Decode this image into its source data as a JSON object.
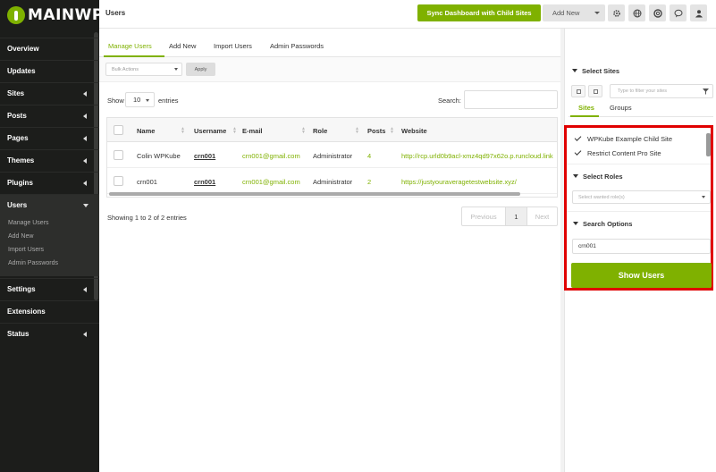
{
  "brand": {
    "logo_text": "MAINWP",
    "accent": "#7fb100",
    "sidebar_bg": "#1c1d1b",
    "highlight": "#e00000"
  },
  "sidebar": {
    "items": [
      {
        "label": "Overview",
        "arrow": false
      },
      {
        "label": "Updates",
        "arrow": false
      },
      {
        "label": "Sites",
        "arrow": true
      },
      {
        "label": "Posts",
        "arrow": true
      },
      {
        "label": "Pages",
        "arrow": true
      },
      {
        "label": "Themes",
        "arrow": true
      },
      {
        "label": "Plugins",
        "arrow": true
      },
      {
        "label": "Users",
        "arrow": true,
        "open": true
      },
      {
        "label": "Settings",
        "arrow": true
      },
      {
        "label": "Extensions",
        "arrow": false
      },
      {
        "label": "Status",
        "arrow": true
      }
    ],
    "submenu": [
      "Manage Users",
      "Add New",
      "Import Users",
      "Admin Passwords"
    ]
  },
  "header": {
    "title": "Users",
    "sync_label": "Sync Dashboard with Child Sites",
    "add_new_label": "Add New",
    "icons": [
      "gear-icon",
      "globe-icon",
      "help-icon",
      "chat-icon",
      "user-icon"
    ]
  },
  "tabs": [
    "Manage Users",
    "Add New",
    "Import Users",
    "Admin Passwords"
  ],
  "actions": {
    "bulk_placeholder": "Bulk Actions",
    "apply_label": "Apply"
  },
  "entries": {
    "show": "Show",
    "value": "10",
    "suffix": "entries",
    "search_label": "Search:"
  },
  "table": {
    "columns": [
      "Name",
      "Username",
      "E-mail",
      "Role",
      "Posts",
      "Website"
    ],
    "rows": [
      {
        "name": "Colin WPKube",
        "username": "crn001",
        "email": "crn001@gmail.com",
        "role": "Administrator",
        "posts": "4",
        "website": "http://rcp.urld0b9acl-xmz4qd97x62o.p.runcloud.link"
      },
      {
        "name": "crn001",
        "username": "crn001",
        "email": "crn001@gmail.com",
        "role": "Administrator",
        "posts": "2",
        "website": "https://justyouraveragetestwebsite.xyz/"
      }
    ]
  },
  "footer": {
    "showing": "Showing 1 to 2 of 2 entries",
    "prev": "Previous",
    "page": "1",
    "next": "Next"
  },
  "right_panel": {
    "select_sites": "Select Sites",
    "filter_placeholder": "Type to filter your sites",
    "tab_sites": "Sites",
    "tab_groups": "Groups",
    "sites": [
      "WPKube Example Child Site",
      "Restrict Content Pro Site"
    ],
    "select_roles": "Select Roles",
    "roles_placeholder": "Select wanted role(s)",
    "search_options": "Search Options",
    "search_value": "crn001",
    "show_users": "Show Users"
  }
}
